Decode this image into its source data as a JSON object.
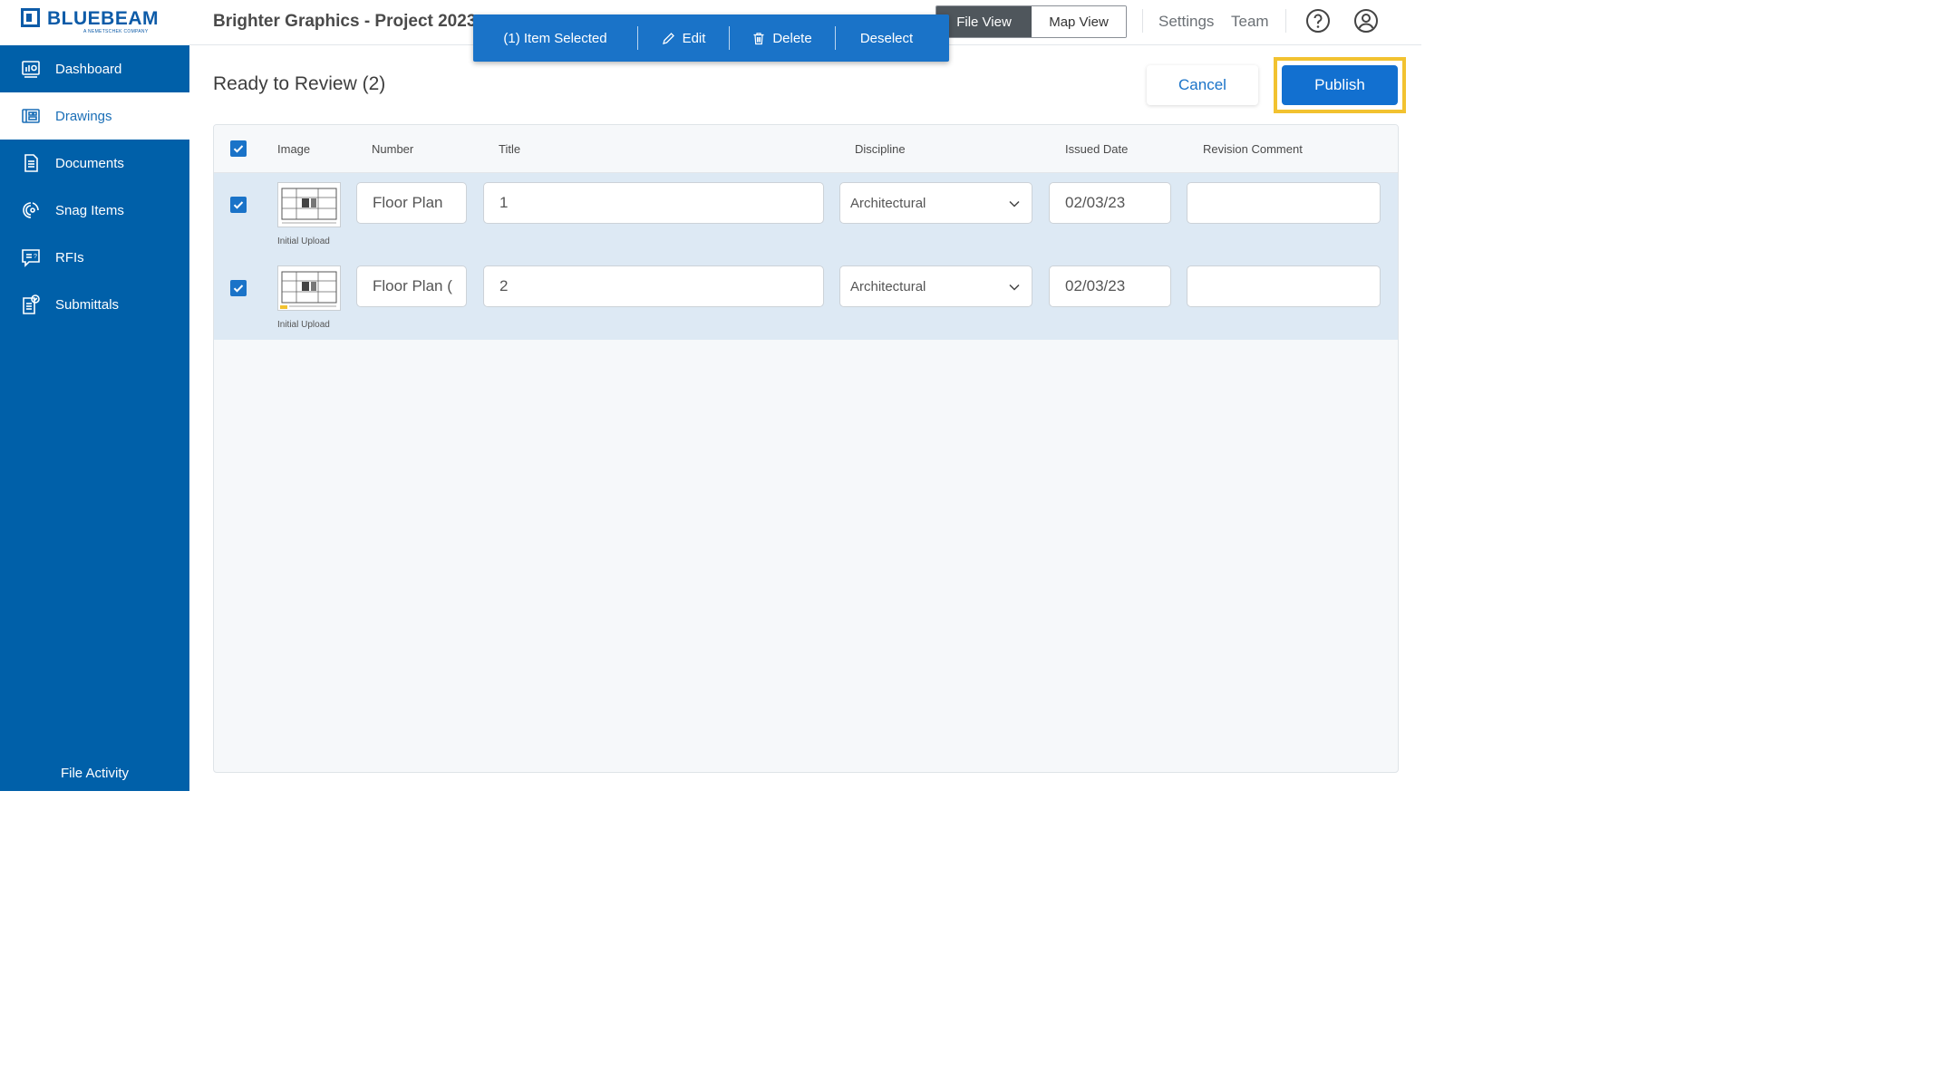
{
  "brand": {
    "name": "BLUEBEAM",
    "tagline": "A NEMETSCHEK COMPANY"
  },
  "sidebar": {
    "items": [
      {
        "label": "Dashboard",
        "icon": "dashboard-icon"
      },
      {
        "label": "Drawings",
        "icon": "drawings-icon",
        "active": true
      },
      {
        "label": "Documents",
        "icon": "documents-icon"
      },
      {
        "label": "Snag Items",
        "icon": "snag-icon"
      },
      {
        "label": "RFIs",
        "icon": "rfi-icon"
      },
      {
        "label": "Submittals",
        "icon": "submittals-icon"
      }
    ],
    "footer": "File Activity"
  },
  "header": {
    "project_title": "Brighter Graphics - Project 2023",
    "view_toggle": {
      "file": "File View",
      "map": "Map View",
      "selected": "File View"
    },
    "links": {
      "settings": "Settings",
      "team": "Team"
    },
    "icons": {
      "help": "help-icon",
      "account": "account-icon"
    }
  },
  "selection_bar": {
    "count_label": "(1) Item Selected",
    "edit": "Edit",
    "delete": "Delete",
    "deselect": "Deselect"
  },
  "main": {
    "title": "Ready to Review (2)",
    "cancel": "Cancel",
    "publish": "Publish"
  },
  "table": {
    "columns": [
      "Image",
      "Number",
      "Title",
      "Discipline",
      "Issued Date",
      "Revision Comment"
    ],
    "rows": [
      {
        "checked": true,
        "image_label": "Initial Upload",
        "number": "Floor Plan",
        "title": "1",
        "discipline": "Architectural",
        "issued_date": "02/03/23",
        "revision_comment": ""
      },
      {
        "checked": true,
        "image_label": "Initial Upload",
        "number": "Floor Plan (",
        "title": "2",
        "discipline": "Architectural",
        "issued_date": "02/03/23",
        "revision_comment": ""
      }
    ]
  },
  "colors": {
    "sidebar": "#0060a9",
    "accent": "#1a73c8",
    "highlight": "#f2c230"
  }
}
